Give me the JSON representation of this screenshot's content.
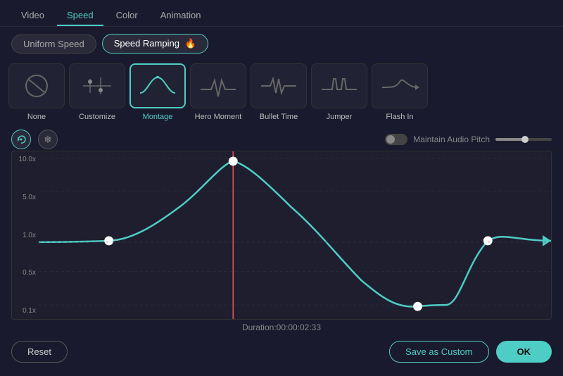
{
  "topNav": {
    "tabs": [
      "Video",
      "Speed",
      "Color",
      "Animation"
    ],
    "activeTab": "Speed"
  },
  "modeRow": {
    "buttons": [
      "Uniform Speed",
      "Speed Ramping"
    ],
    "active": "Speed Ramping",
    "fireIcon": "🔥"
  },
  "presets": [
    {
      "id": "none",
      "label": "None",
      "icon": "none"
    },
    {
      "id": "customize",
      "label": "Customize",
      "icon": "customize"
    },
    {
      "id": "montage",
      "label": "Montage",
      "icon": "montage",
      "selected": true
    },
    {
      "id": "hero-moment",
      "label": "Hero Moment",
      "icon": "hero"
    },
    {
      "id": "bullet-time",
      "label": "Bullet Time",
      "icon": "bullet"
    },
    {
      "id": "jumper",
      "label": "Jumper",
      "icon": "jumper"
    },
    {
      "id": "flash-in",
      "label": "Flash In",
      "icon": "flashin"
    }
  ],
  "controls": {
    "undoIcon": "↺",
    "snowflakeIcon": "❄",
    "audioLabel": "Maintain Audio Pitch"
  },
  "chart": {
    "yLabels": [
      "10.0x",
      "5.0x",
      "1.0x",
      "0.5x",
      "0.1x"
    ],
    "redLineX": 0.38
  },
  "duration": {
    "label": "Duration:",
    "value": "00:00:02:33"
  },
  "footer": {
    "resetLabel": "Reset",
    "saveLabel": "Save as Custom",
    "okLabel": "OK"
  }
}
